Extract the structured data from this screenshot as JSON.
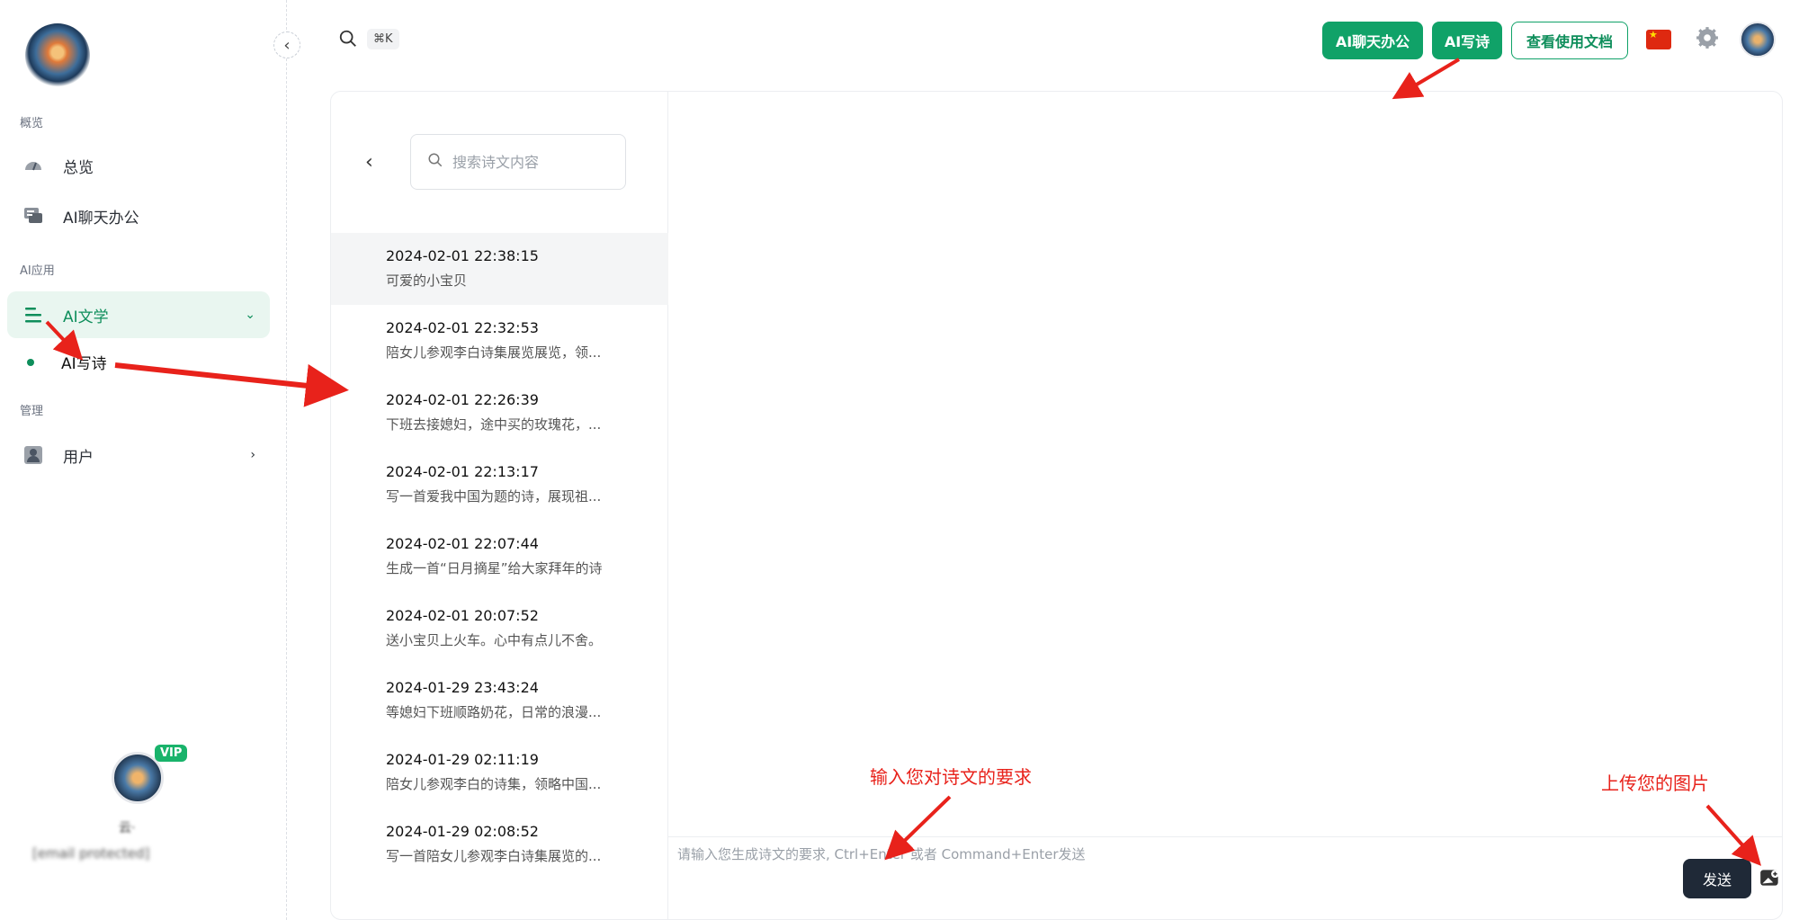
{
  "sidebar": {
    "group_overview": "概览",
    "item_overview": "总览",
    "item_chat": "AI聊天办公",
    "group_apps": "AI应用",
    "item_literature": "AI文学",
    "sub_poem": "AI写诗",
    "group_admin": "管理",
    "item_users": "用户",
    "vip_badge": "VIP",
    "user_name": "云·",
    "user_email": "[email protected]"
  },
  "topbar": {
    "shortcut": "⌘K",
    "btn_chat": "AI聊天办公",
    "btn_poem": "AI写诗",
    "btn_docs": "查看使用文档",
    "flag_icon": "china-flag-icon"
  },
  "history": {
    "search_placeholder": "搜索诗文内容",
    "items": [
      {
        "time": "2024-02-01 22:38:15",
        "title": "可爱的小宝贝"
      },
      {
        "time": "2024-02-01 22:32:53",
        "title": "陪女儿参观李白诗集展览展览，领..."
      },
      {
        "time": "2024-02-01 22:26:39",
        "title": "下班去接媳妇，途中买的玫瑰花，..."
      },
      {
        "time": "2024-02-01 22:13:17",
        "title": "写一首爱我中国为题的诗，展现祖..."
      },
      {
        "time": "2024-02-01 22:07:44",
        "title": "生成一首“日月摘星”给大家拜年的诗"
      },
      {
        "time": "2024-02-01 20:07:52",
        "title": "送小宝贝上火车。心中有点儿不舍。"
      },
      {
        "time": "2024-01-29 23:43:24",
        "title": "等媳妇下班顺路奶花，日常的浪漫..."
      },
      {
        "time": "2024-01-29 02:11:19",
        "title": "陪女儿参观李白的诗集，领略中国..."
      },
      {
        "time": "2024-01-29 02:08:52",
        "title": "写一首陪女儿参观李白诗集展览的..."
      }
    ]
  },
  "composer": {
    "placeholder": "请输入您生成诗文的要求, Ctrl+Enter 或者 Command+Enter发送",
    "send_label": "发送"
  },
  "annotations": {
    "input_hint": "输入您对诗文的要求",
    "upload_hint": "上传您的图片"
  },
  "colors": {
    "accent": "#10a268",
    "annotation": "#e8221b"
  }
}
